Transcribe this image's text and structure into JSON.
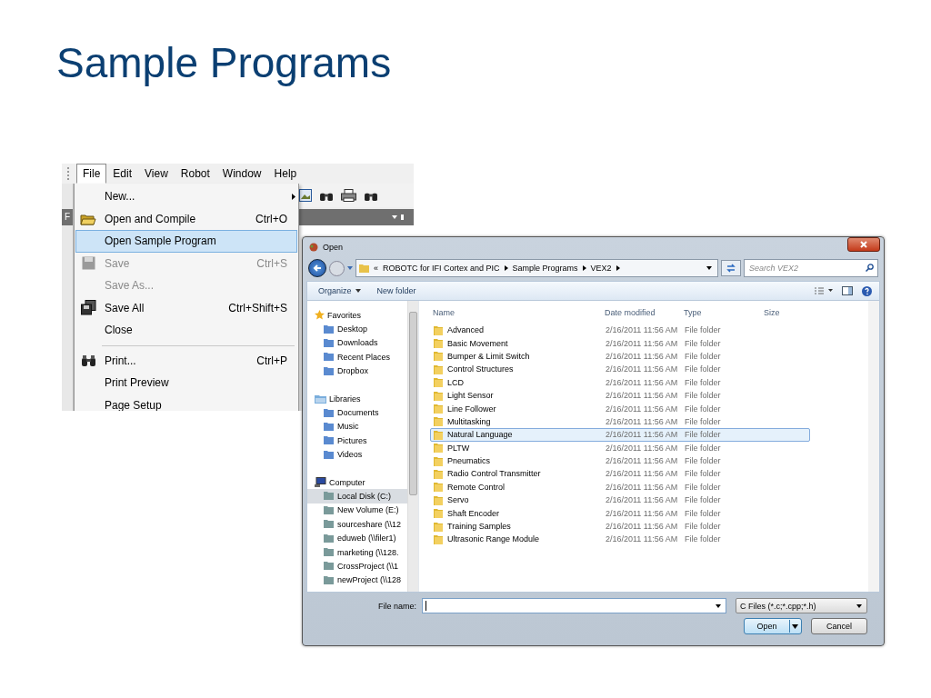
{
  "slide": {
    "title": "Sample Programs"
  },
  "ide": {
    "menubar": [
      {
        "label": "File",
        "selected": true
      },
      {
        "label": "Edit",
        "selected": false
      },
      {
        "label": "View",
        "selected": false
      },
      {
        "label": "Robot",
        "selected": false
      },
      {
        "label": "Window",
        "selected": false
      },
      {
        "label": "Help",
        "selected": false
      }
    ],
    "panel_title": "F",
    "file_menu": [
      {
        "kind": "item",
        "label": "New...",
        "submenu": true,
        "disabled": false,
        "selected": false
      },
      {
        "kind": "item",
        "label": "Open and Compile",
        "shortcut": "Ctrl+O",
        "disabled": false,
        "selected": false
      },
      {
        "kind": "item",
        "label": "Open Sample Program",
        "disabled": false,
        "selected": true
      },
      {
        "kind": "item",
        "label": "Save",
        "shortcut": "Ctrl+S",
        "disabled": true,
        "selected": false
      },
      {
        "kind": "item",
        "label": "Save As...",
        "disabled": true,
        "selected": false
      },
      {
        "kind": "item",
        "label": "Save All",
        "shortcut": "Ctrl+Shift+S",
        "disabled": false,
        "selected": false
      },
      {
        "kind": "item",
        "label": "Close",
        "disabled": false,
        "selected": false
      },
      {
        "kind": "separator"
      },
      {
        "kind": "item",
        "label": "Print...",
        "shortcut": "Ctrl+P",
        "disabled": false,
        "selected": false
      },
      {
        "kind": "item",
        "label": "Print Preview",
        "disabled": false,
        "selected": false
      },
      {
        "kind": "item",
        "label": "Page Setup",
        "disabled": false,
        "selected": false
      }
    ]
  },
  "open_dialog": {
    "title": "Open",
    "breadcrumb": [
      "«",
      "ROBOTC for IFI Cortex and PIC",
      "Sample Programs",
      "VEX2"
    ],
    "search": {
      "placeholder": "Search VEX2"
    },
    "toolbar": [
      {
        "label": "Organize",
        "dropdown": true
      },
      {
        "label": "New folder",
        "dropdown": false
      }
    ],
    "navigation": [
      {
        "label": "Favorites",
        "children": [
          {
            "label": "Desktop",
            "selected": false
          },
          {
            "label": "Downloads",
            "selected": false
          },
          {
            "label": "Recent Places",
            "selected": false
          },
          {
            "label": "Dropbox",
            "selected": false
          }
        ]
      },
      {
        "label": "Libraries",
        "children": [
          {
            "label": "Documents",
            "selected": false
          },
          {
            "label": "Music",
            "selected": false
          },
          {
            "label": "Pictures",
            "selected": false
          },
          {
            "label": "Videos",
            "selected": false
          }
        ]
      },
      {
        "label": "Computer",
        "children": [
          {
            "label": "Local Disk (C:)",
            "selected": true
          },
          {
            "label": "New Volume (E:)",
            "selected": false
          },
          {
            "label": "sourceshare (\\\\12",
            "selected": false
          },
          {
            "label": "eduweb (\\\\filer1)",
            "selected": false
          },
          {
            "label": "marketing (\\\\128.",
            "selected": false
          },
          {
            "label": "CrossProject (\\\\1",
            "selected": false
          },
          {
            "label": "newProject (\\\\128",
            "selected": false
          }
        ]
      }
    ],
    "columns": [
      "Name",
      "Date modified",
      "Type",
      "Size"
    ],
    "rows": [
      {
        "name": "Advanced",
        "date_modified": "2/16/2011 11:56 AM",
        "type": "File folder",
        "selected": false
      },
      {
        "name": "Basic Movement",
        "date_modified": "2/16/2011 11:56 AM",
        "type": "File folder",
        "selected": false
      },
      {
        "name": "Bumper & Limit Switch",
        "date_modified": "2/16/2011 11:56 AM",
        "type": "File folder",
        "selected": false
      },
      {
        "name": "Control Structures",
        "date_modified": "2/16/2011 11:56 AM",
        "type": "File folder",
        "selected": false
      },
      {
        "name": "LCD",
        "date_modified": "2/16/2011 11:56 AM",
        "type": "File folder",
        "selected": false
      },
      {
        "name": "Light Sensor",
        "date_modified": "2/16/2011 11:56 AM",
        "type": "File folder",
        "selected": false
      },
      {
        "name": "Line Follower",
        "date_modified": "2/16/2011 11:56 AM",
        "type": "File folder",
        "selected": false
      },
      {
        "name": "Multitasking",
        "date_modified": "2/16/2011 11:56 AM",
        "type": "File folder",
        "selected": false
      },
      {
        "name": "Natural Language",
        "date_modified": "2/16/2011 11:56 AM",
        "type": "File folder",
        "selected": true
      },
      {
        "name": "PLTW",
        "date_modified": "2/16/2011 11:56 AM",
        "type": "File folder",
        "selected": false
      },
      {
        "name": "Pneumatics",
        "date_modified": "2/16/2011 11:56 AM",
        "type": "File folder",
        "selected": false
      },
      {
        "name": "Radio Control Transmitter",
        "date_modified": "2/16/2011 11:56 AM",
        "type": "File folder",
        "selected": false
      },
      {
        "name": "Remote Control",
        "date_modified": "2/16/2011 11:56 AM",
        "type": "File folder",
        "selected": false
      },
      {
        "name": "Servo",
        "date_modified": "2/16/2011 11:56 AM",
        "type": "File folder",
        "selected": false
      },
      {
        "name": "Shaft Encoder",
        "date_modified": "2/16/2011 11:56 AM",
        "type": "File folder",
        "selected": false
      },
      {
        "name": "Training Samples",
        "date_modified": "2/16/2011 11:56 AM",
        "type": "File folder",
        "selected": false
      },
      {
        "name": "Ultrasonic Range Module",
        "date_modified": "2/16/2011 11:56 AM",
        "type": "File folder",
        "selected": false
      }
    ],
    "file_name_label": "File name:",
    "file_type": "C Files (*.c;*.cpp;*.h)",
    "buttons": [
      {
        "label": "Open",
        "kind": "split"
      },
      {
        "label": "Cancel",
        "kind": "plain"
      }
    ]
  }
}
